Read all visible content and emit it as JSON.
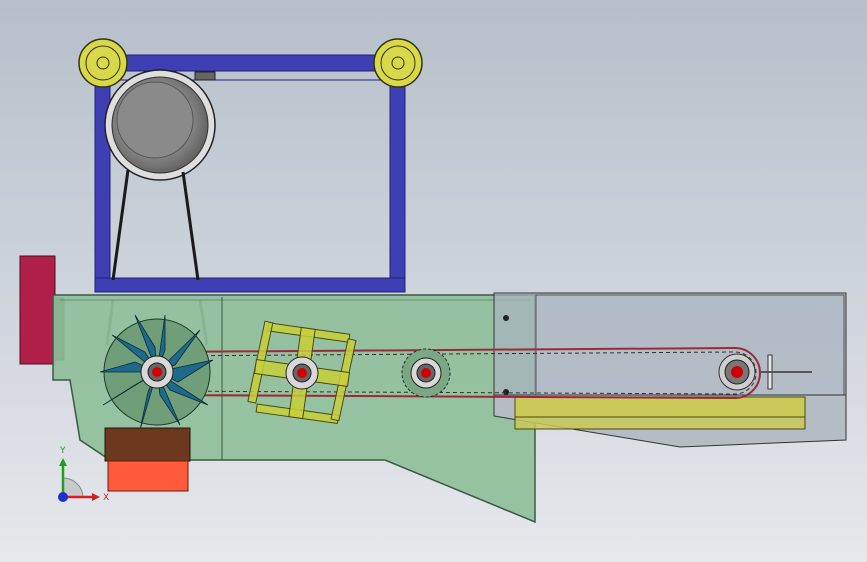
{
  "viewport": {
    "background_top": "#b6bfca",
    "background_bottom": "#e6e8ec"
  },
  "colors": {
    "frame": "#3d3fb3",
    "frame_edge": "#22237a",
    "housing": "#8fbf9a",
    "housing_edge": "#3a5a44",
    "hopper": "#a8b3be",
    "yellow_part": "#c9c957",
    "red_block": "#b01f4a",
    "brown_block": "#6b3a1e",
    "orange_block": "#ff5a3c",
    "impeller": "#1e6a8a",
    "paddle": "#c8cf3a",
    "pulley_yellow": "#d8d84a",
    "motor": "#8c8c8c",
    "chain": "#9a2a3a",
    "hub_red": "#d00000"
  },
  "axis_triad": {
    "x_label": "X",
    "y_label": "Y",
    "x_color": "#d02020",
    "y_color": "#20a020",
    "z_color": "#2030d0"
  }
}
